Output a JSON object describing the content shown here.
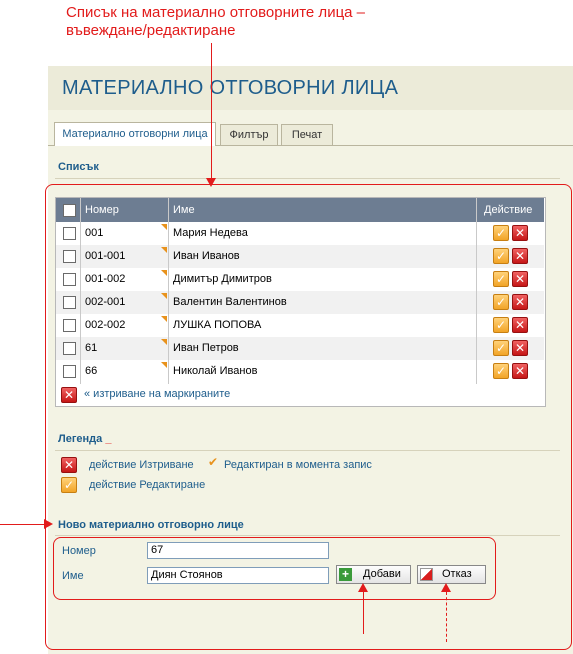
{
  "annotation": {
    "title_line1": "Списък на материално отговорните лица –",
    "title_line2": "въвеждане/редактиране"
  },
  "page": {
    "title": "МАТЕРИАЛНО ОТГОВОРНИ ЛИЦА"
  },
  "tabs": [
    {
      "label": "Материално отговорни лица",
      "active": true
    },
    {
      "label": "Филтър",
      "active": false
    },
    {
      "label": "Печат",
      "active": false
    }
  ],
  "list": {
    "heading": "Списък",
    "columns": {
      "number": "Номер",
      "name": "Име",
      "action": "Действие"
    },
    "rows": [
      {
        "number": "001",
        "name": "Мария Недева"
      },
      {
        "number": "001-001",
        "name": "Иван Иванов"
      },
      {
        "number": "001-002",
        "name": "Димитър Димитров"
      },
      {
        "number": "002-001",
        "name": "Валентин Валентинов"
      },
      {
        "number": "002-002",
        "name": "ЛУШКА ПОПОВА"
      },
      {
        "number": "61",
        "name": "Иван Петров"
      },
      {
        "number": "66",
        "name": "Николай Иванов"
      }
    ],
    "delete_marked": "« изтриване на маркираните"
  },
  "legend": {
    "heading": "Легенда",
    "delete_action": "действие Изтриване",
    "edited_note": "Редактиран в момента запис",
    "edit_action": "действие Редактиране"
  },
  "form": {
    "heading": "Ново материално отговорно лице",
    "number_label": "Номер",
    "number_value": "67",
    "name_label": "Име",
    "name_value": "Диян Стоянов",
    "add_label": "Добави",
    "cancel_label": "Отказ"
  },
  "colors": {
    "annotation": "#e21b1b",
    "accent": "#1e5d8c",
    "table_header": "#6d7d92",
    "edit_icon": "#f2a427",
    "delete_icon": "#c51616"
  }
}
